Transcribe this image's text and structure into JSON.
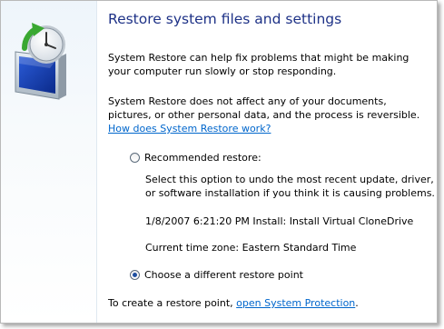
{
  "header": {
    "title": "Restore system files and settings"
  },
  "intro": {
    "p1": "System Restore can help fix problems that might be making your computer run slowly or stop responding.",
    "p2_text": "System Restore does not affect any of your documents, pictures, or other personal data, and the process is reversible. ",
    "p2_link": "How does System Restore work?"
  },
  "recommended": {
    "label": "Recommended restore:",
    "description": "Select this option to undo the most recent update, driver, or software installation if you think it is causing problems.",
    "restore_point": "1/8/2007 6:21:20 PM Install: Install Virtual CloneDrive",
    "time_zone": "Current time zone: Eastern Standard Time"
  },
  "different": {
    "label": "Choose a different restore point",
    "selected": true
  },
  "footer": {
    "text": "To create a restore point, ",
    "link": "open System Protection",
    "suffix": "."
  },
  "icons": {
    "wizard": "system-restore-icon"
  },
  "colors": {
    "title": "#1e3287",
    "link": "#0066cc"
  }
}
